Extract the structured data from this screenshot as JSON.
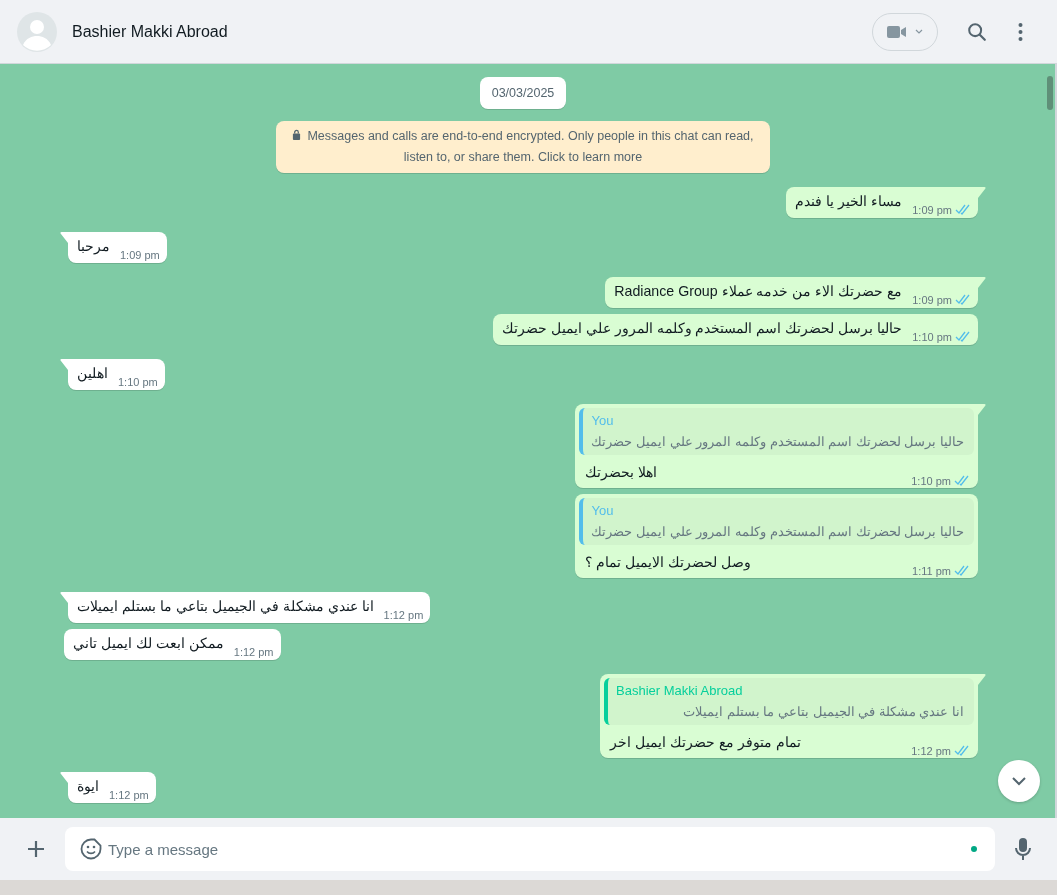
{
  "header": {
    "contact_name": "Bashier Makki Abroad"
  },
  "chat": {
    "date_chip": "03/03/2025",
    "encryption_notice": "Messages and calls are end-to-end encrypted. Only people in this chat can read, listen to, or share them. Click to learn more",
    "messages": [
      {
        "kind": "out",
        "tail": true,
        "text": "مساء الخير يا فندم",
        "time": "1:09 pm",
        "read": true
      },
      {
        "kind": "in",
        "tail": true,
        "text": "مرحبا",
        "time": "1:09 pm"
      },
      {
        "kind": "out",
        "tail": true,
        "text": "مع حضرتك الاء من خدمه عملاء Radiance Group",
        "time": "1:09 pm",
        "read": true
      },
      {
        "kind": "out",
        "tail": false,
        "text": "حاليا برسل لحضرتك اسم المستخدم وكلمه المرور علي ايميل حضرتك",
        "time": "1:10 pm",
        "read": true
      },
      {
        "kind": "in",
        "tail": true,
        "text": "اهلين",
        "time": "1:10 pm"
      },
      {
        "kind": "out",
        "tail": true,
        "quote": {
          "sender": "You",
          "text": "حاليا برسل لحضرتك اسم المستخدم وكلمه المرور علي ايميل حضرتك",
          "color": "#53bdeb"
        },
        "text": "اهلا بحضرتك",
        "time": "1:10 pm",
        "read": true
      },
      {
        "kind": "out",
        "tail": false,
        "quote": {
          "sender": "You",
          "text": "حاليا برسل لحضرتك اسم المستخدم وكلمه المرور علي ايميل حضرتك",
          "color": "#53bdeb"
        },
        "text": "وصل لحضرتك الايميل تمام ؟",
        "time": "1:11 pm",
        "read": true
      },
      {
        "kind": "in",
        "tail": true,
        "text": "انا عندي مشكلة في الجيميل بتاعي ما بستلم ايميلات",
        "time": "1:12 pm"
      },
      {
        "kind": "in",
        "tail": false,
        "text": "ممكن ابعت لك ايميل تاني",
        "time": "1:12 pm"
      },
      {
        "kind": "out",
        "tail": true,
        "quote": {
          "sender": "Bashier Makki Abroad",
          "text": "انا عندي مشكلة في الجيميل بتاعي ما بستلم ايميلات",
          "color": "#06cf9c"
        },
        "text": "تمام متوفر مع حضرتك ايميل اخر",
        "time": "1:12 pm",
        "read": true
      },
      {
        "kind": "in",
        "tail": true,
        "text": "ايوة",
        "time": "1:12 pm"
      }
    ]
  },
  "composer": {
    "placeholder": "Type a message"
  }
}
